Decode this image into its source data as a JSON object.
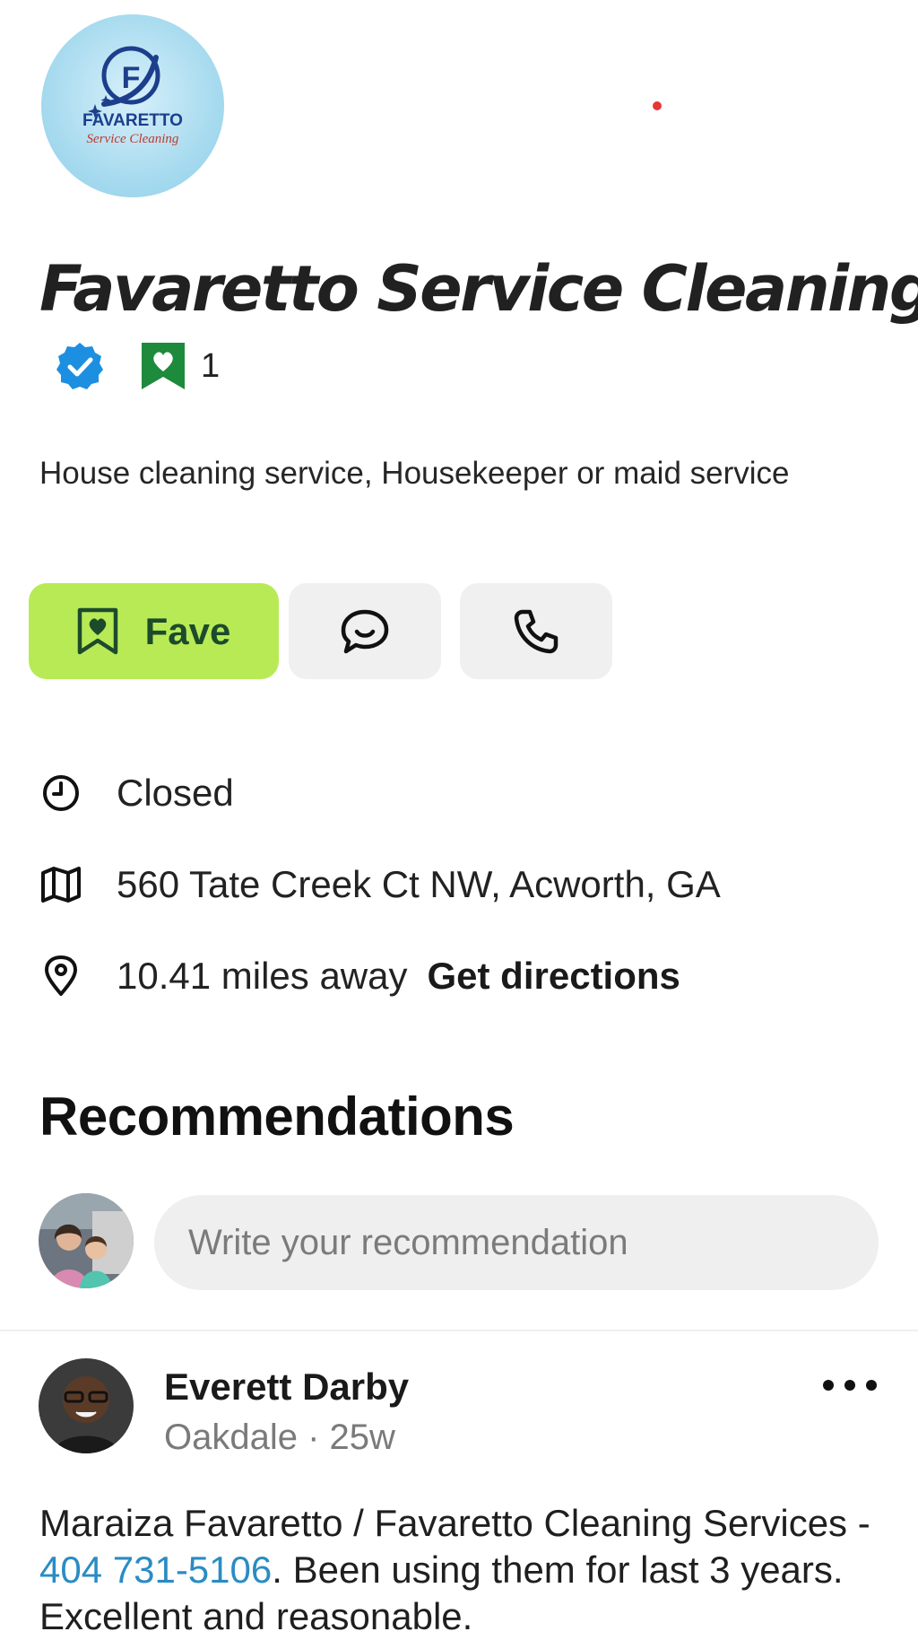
{
  "business": {
    "logo_text": "FAVARETTO",
    "logo_subtext": "Service Cleaning",
    "logo_letter": "F",
    "name": "Favaretto Service Cleaning",
    "fave_count": "1",
    "categories": "House cleaning service, Housekeeper or maid service"
  },
  "actions": {
    "fave_label": "Fave",
    "chat_icon": "chat-bubble-icon",
    "call_icon": "phone-icon"
  },
  "info": {
    "status": "Closed",
    "address": "560 Tate Creek Ct NW, Acworth, GA",
    "distance": "10.41 miles away",
    "directions_label": "Get directions"
  },
  "recommendations": {
    "heading": "Recommendations",
    "input_placeholder": "Write your recommendation",
    "posts": [
      {
        "author": "Everett Darby",
        "meta": "Oakdale · 25w",
        "text_before": "Maraiza Favaretto / Favaretto Cleaning Services - ",
        "phone": "404 731-5106",
        "text_after": ". Been using them for last 3 years. Excellent and reasonable."
      }
    ]
  },
  "colors": {
    "fave_button": "#b8ea56",
    "fave_green": "#1e8a3c",
    "verified_blue": "#1d8fe0",
    "link_blue": "#2a8cc4",
    "status_dot": "#e53935"
  }
}
